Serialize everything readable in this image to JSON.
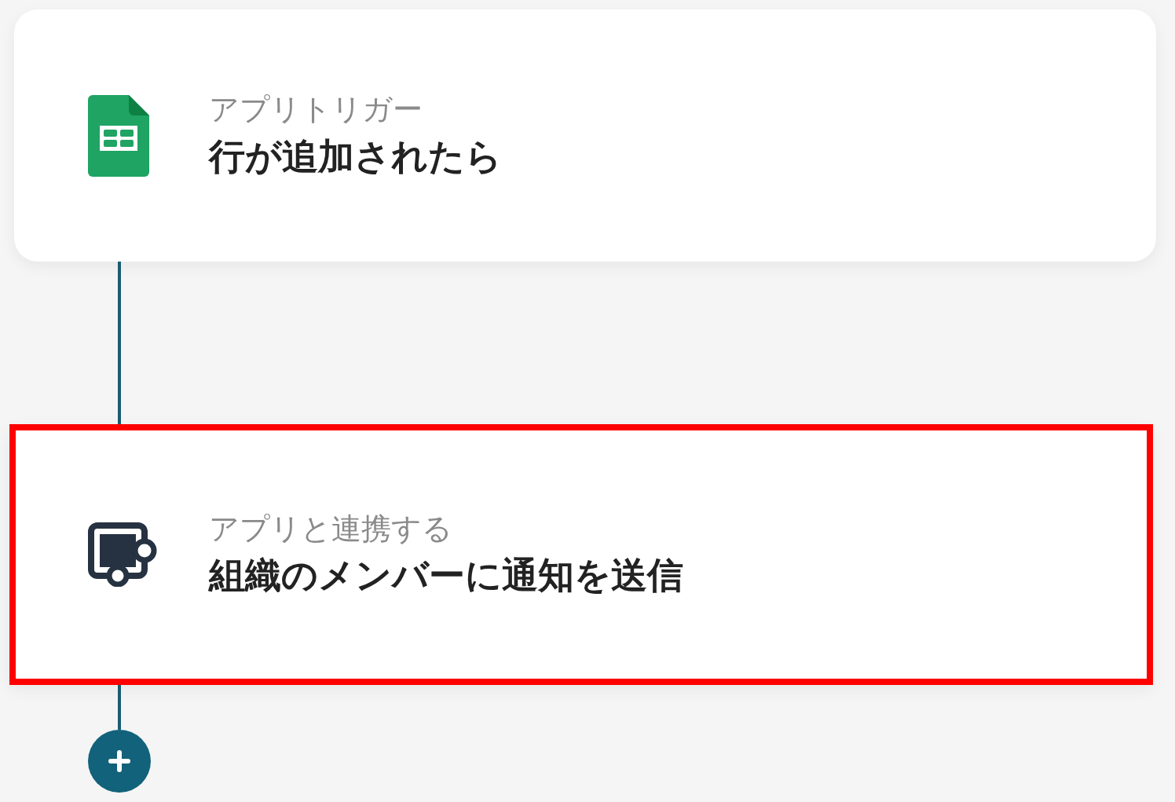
{
  "steps": [
    {
      "kind": "sheets",
      "label": "アプリトリガー",
      "title": "行が追加されたら",
      "highlighted": false
    },
    {
      "kind": "connect",
      "label": "アプリと連携する",
      "title": "組織のメンバーに通知を送信",
      "highlighted": true
    }
  ],
  "add_button": {
    "kind": "plus"
  }
}
